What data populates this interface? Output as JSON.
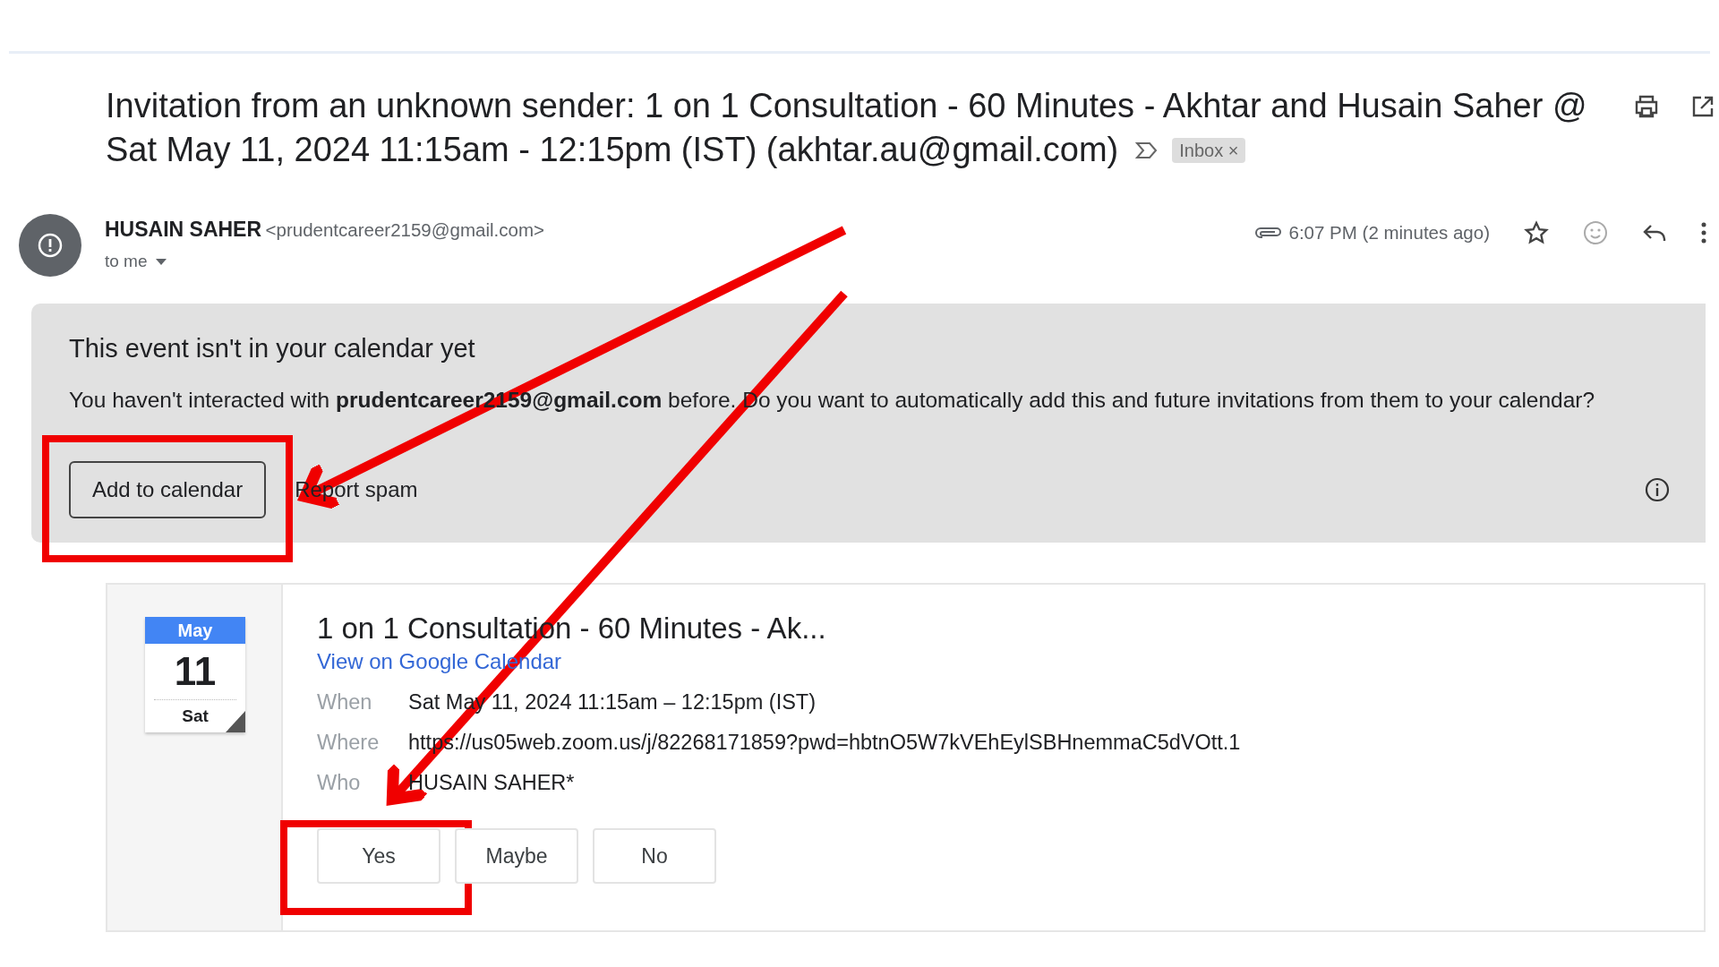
{
  "email": {
    "subject_lines": [
      "Invitation from an unknown sender: 1 on 1 Consultation - 60 Minutes - Akhtar and Husain Saher @",
      "Sat May 11, 2024 11:15am - 12:15pm (IST) (akhtar.au@gmail.com)"
    ],
    "label": "Inbox",
    "label_close": "×"
  },
  "sender": {
    "name": "HUSAIN SAHER",
    "address": "<prudentcareer2159@gmail.com>",
    "recipient": "to me",
    "time": "6:07 PM (2 minutes ago)"
  },
  "banner": {
    "title": "This event isn't in your calendar yet",
    "message": "You haven't interacted with **prudentcareer2159@gmail.com** before. Do you want to automatically add this and future invitations from them to your calendar?",
    "actions": [
      {
        "label": "Add to calendar",
        "kind": "outline"
      },
      {
        "label": "Report spam",
        "kind": "text"
      }
    ]
  },
  "event": {
    "month": "May",
    "day": "11",
    "weekday": "Sat",
    "title": "1 on 1 Consultation - 60 Minutes - Ak...",
    "link": "View on Google Calendar",
    "details": [
      {
        "label": "When",
        "value": "Sat May 11, 2024 11:15am – 12:15pm (IST)"
      },
      {
        "label": "Where",
        "value": "https://us05web.zoom.us/j/82268171859?pwd=hbtnO5W7kVEhEylSBHnemmaC5dVOtt.1"
      },
      {
        "label": "Who",
        "value": "HUSAIN SAHER*"
      }
    ],
    "rsvp": [
      "Yes",
      "Maybe",
      "No"
    ]
  }
}
